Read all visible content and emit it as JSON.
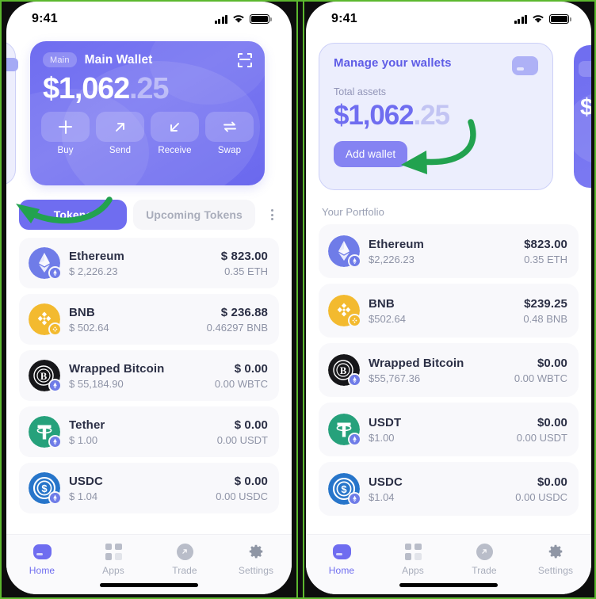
{
  "meta": {
    "accent_purple": "#6f6df0",
    "annotation_green": "#22a24f",
    "frame_green": "#5cb82e"
  },
  "status_bar": {
    "time": "9:41",
    "icons": [
      "cellular-signal-icon",
      "wifi-icon",
      "battery-icon"
    ]
  },
  "left_screen": {
    "wallet_card": {
      "tag": "Main",
      "name": "Main Wallet",
      "scan_icon": "scan-qr-icon",
      "balance_main": "$1,062",
      "balance_cents": ".25",
      "actions": [
        {
          "label": "Buy",
          "icon": "plus-icon"
        },
        {
          "label": "Send",
          "icon": "arrow-up-right-icon"
        },
        {
          "label": "Receive",
          "icon": "arrow-down-left-icon"
        },
        {
          "label": "Swap",
          "icon": "swap-arrows-icon"
        }
      ]
    },
    "tabs": {
      "active": "Tokens",
      "inactive": "Upcoming Tokens",
      "menu_icon": "kebab-menu-icon"
    },
    "tokens": [
      {
        "name": "Ethereum",
        "price": "$ 2,226.23",
        "value": "$ 823.00",
        "amount": "0.35 ETH",
        "symbol": "ETH",
        "color": "#6f7ce8",
        "badge": "#6f7ce8"
      },
      {
        "name": "BNB",
        "price": "$ 502.64",
        "value": "$ 236.88",
        "amount": "0.46297 BNB",
        "symbol": "BNB",
        "color": "#f3ba2f",
        "badge": "#f3ba2f"
      },
      {
        "name": "Wrapped Bitcoin",
        "price": "$ 55,184.90",
        "value": "$ 0.00",
        "amount": "0.00 WBTC",
        "symbol": "WBTC",
        "color": "#17171a",
        "badge": "#6f7ce8"
      },
      {
        "name": "Tether",
        "price": "$ 1.00",
        "value": "$ 0.00",
        "amount": "0.00 USDT",
        "symbol": "USDT",
        "color": "#26a17b",
        "badge": "#6f7ce8"
      },
      {
        "name": "USDC",
        "price": "$ 1.04",
        "value": "$ 0.00",
        "amount": "0.00 USDC",
        "symbol": "USDC",
        "color": "#2775ca",
        "badge": "#6f7ce8"
      }
    ]
  },
  "right_screen": {
    "manage_card": {
      "title": "Manage your wallets",
      "wallet_icon": "wallet-icon",
      "subtitle": "Total assets",
      "balance_main": "$1,062",
      "balance_cents": ".25",
      "button": "Add wallet"
    },
    "portfolio_label": "Your Portfolio",
    "tokens": [
      {
        "name": "Ethereum",
        "price": "$2,226.23",
        "value": "$823.00",
        "amount": "0.35 ETH",
        "symbol": "ETH",
        "color": "#6f7ce8",
        "badge": "#6f7ce8"
      },
      {
        "name": "BNB",
        "price": "$502.64",
        "value": "$239.25",
        "amount": "0.48 BNB",
        "symbol": "BNB",
        "color": "#f3ba2f",
        "badge": "#f3ba2f"
      },
      {
        "name": "Wrapped Bitcoin",
        "price": "$55,767.36",
        "value": "$0.00",
        "amount": "0.00 WBTC",
        "symbol": "WBTC",
        "color": "#17171a",
        "badge": "#6f7ce8"
      },
      {
        "name": "USDT",
        "price": "$1.00",
        "value": "$0.00",
        "amount": "0.00 USDT",
        "symbol": "USDT",
        "color": "#26a17b",
        "badge": "#6f7ce8"
      },
      {
        "name": "USDC",
        "price": "$1.04",
        "value": "$0.00",
        "amount": "0.00 USDC",
        "symbol": "USDC",
        "color": "#2775ca",
        "badge": "#6f7ce8"
      }
    ]
  },
  "bottom_nav": {
    "items": [
      {
        "label": "Home",
        "icon": "home-icon",
        "active": true
      },
      {
        "label": "Apps",
        "icon": "apps-grid-icon",
        "active": false
      },
      {
        "label": "Trade",
        "icon": "trade-icon",
        "active": false
      },
      {
        "label": "Settings",
        "icon": "gear-icon",
        "active": false
      }
    ]
  }
}
